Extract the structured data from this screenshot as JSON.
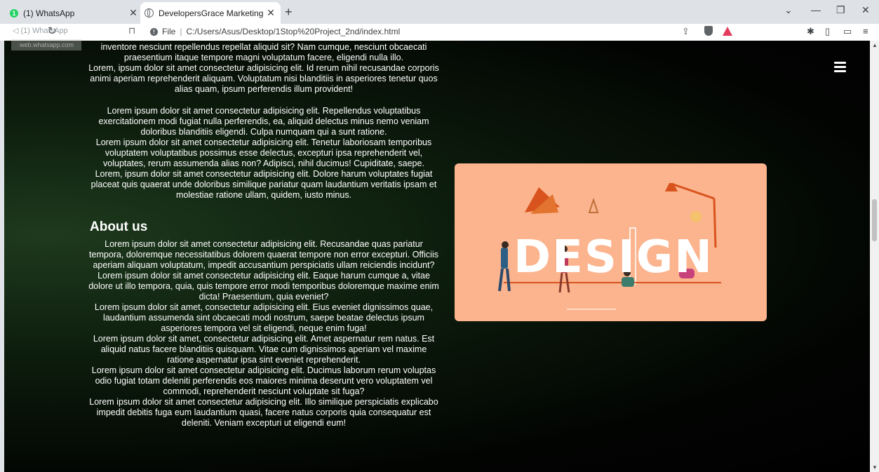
{
  "browser": {
    "tabs": [
      {
        "title": "(1) WhatsApp",
        "badge": "1"
      },
      {
        "title": "DevelopersGrace Marketing and I"
      }
    ],
    "toolbar": {
      "ghost_text": "(1) WhatsApp",
      "tooltip_url": "web.whatsapp.com",
      "scheme_label": "File",
      "url": "C:/Users/Asus/Desktop/1Stop%20Project_2nd/index.html"
    }
  },
  "page": {
    "intro_paragraphs": [
      "inventore nesciunt repellendus repellat aliquid sit? Nam cumque, nesciunt obcaecati praesentium itaque tempore magni voluptatum facere, eligendi nulla illo.",
      "Lorem, ipsum dolor sit amet consectetur adipisicing elit. Id rerum nihil recusandae corporis animi aperiam reprehenderit aliquam. Voluptatum nisi blanditiis in asperiores tenetur quos alias quam, ipsum perferendis illum provident!"
    ],
    "second_block": [
      "Lorem ipsum dolor sit amet consectetur adipisicing elit. Repellendus voluptatibus exercitationem modi fugiat nulla perferendis, ea, aliquid delectus minus nemo veniam doloribus blanditiis eligendi. Culpa numquam qui a sunt ratione.",
      "Lorem ipsum dolor sit amet consectetur adipisicing elit. Tenetur laboriosam temporibus voluptatem voluptatibus possimus esse delectus, excepturi ipsa reprehenderit vel, voluptates, rerum assumenda alias non? Adipisci, nihil ducimus! Cupiditate, saepe.",
      "Lorem, ipsum dolor sit amet consectetur adipisicing elit. Dolore harum voluptates fugiat placeat quis quaerat unde doloribus similique pariatur quam laudantium veritatis ipsam et molestiae ratione ullam, quidem, iusto minus."
    ],
    "about_heading": "About us",
    "about_paragraphs": [
      "Lorem ipsum dolor sit amet consectetur adipisicing elit. Recusandae quas pariatur tempora, doloremque necessitatibus dolorem quaerat tempore non error excepturi. Officiis aperiam aliquam voluptatum, impedit accusantium perspiciatis ullam reiciendis incidunt?",
      "Lorem ipsum dolor sit amet consectetur adipisicing elit. Eaque harum cumque a, vitae dolore ut illo tempora, quia, quis tempore error modi temporibus doloremque maxime enim dicta! Praesentium, quia eveniet?",
      "Lorem ipsum dolor sit amet, consectetur adipisicing elit. Eius eveniet dignissimos quae, laudantium assumenda sint obcaecati modi nostrum, saepe beatae delectus ipsum asperiores tempora vel sit eligendi, neque enim fuga!",
      "Lorem ipsum dolor sit amet, consectetur adipisicing elit. Amet aspernatur rem natus. Est aliquid natus facere blanditiis quisquam. Vitae cum dignissimos aperiam vel maxime ratione aspernatur ipsa sint eveniet reprehenderit.",
      "Lorem ipsum dolor sit amet consectetur adipisicing elit. Ducimus laborum rerum voluptas odio fugiat totam deleniti perferendis eos maiores minima deserunt vero voluptatem vel commodi, reprehenderit nesciunt voluptate sit fuga?",
      "Lorem ipsum dolor sit amet consectetur adipisicing elit. Illo similique perspiciatis explicabo impedit debitis fuga eum laudantium quasi, facere natus corporis quia consequatur est deleniti. Veniam excepturi ut eligendi eum!"
    ],
    "design_image": {
      "word": "DESIGN",
      "bg_color": "#fbb48d"
    }
  }
}
